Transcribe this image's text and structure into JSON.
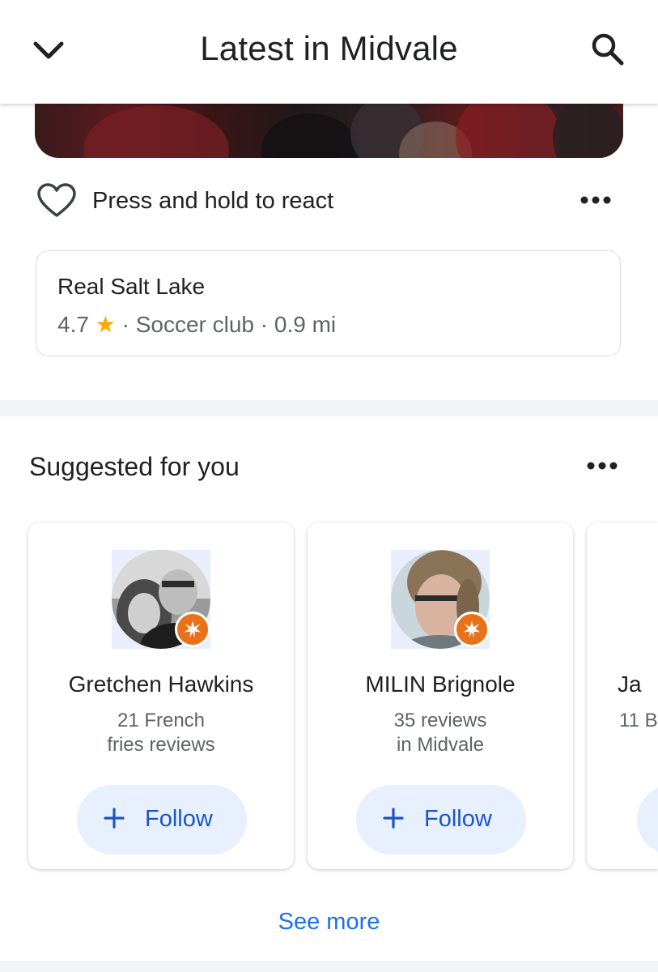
{
  "header": {
    "title": "Latest in Midvale",
    "back_icon": "chevron-down-icon",
    "search_icon": "search-icon"
  },
  "post": {
    "react_label": "Press and hold to react",
    "react_icon": "heart-outline-icon",
    "more_icon": "more-horizontal-icon"
  },
  "place": {
    "name": "Real Salt Lake",
    "rating": "4.7",
    "star": "★",
    "details": "· Soccer club · 0.9 mi"
  },
  "suggested": {
    "title": "Suggested for you",
    "more_icon": "more-horizontal-icon",
    "people": [
      {
        "name": "Gretchen Hawkins",
        "line1": "21 French",
        "line2": "fries reviews",
        "follow_label": "Follow"
      },
      {
        "name": "MILIN Brignole",
        "line1": "35 reviews",
        "line2": "in Midvale",
        "follow_label": "Follow"
      },
      {
        "name": "Ja",
        "line1": "11 B",
        "line2": "",
        "follow_label": ""
      }
    ],
    "see_more_label": "See more"
  },
  "colors": {
    "accent": "#1a73e8",
    "follow_bg": "#e8f0fe",
    "star": "#f9ab00",
    "local_guide_badge": "#e8711a"
  }
}
